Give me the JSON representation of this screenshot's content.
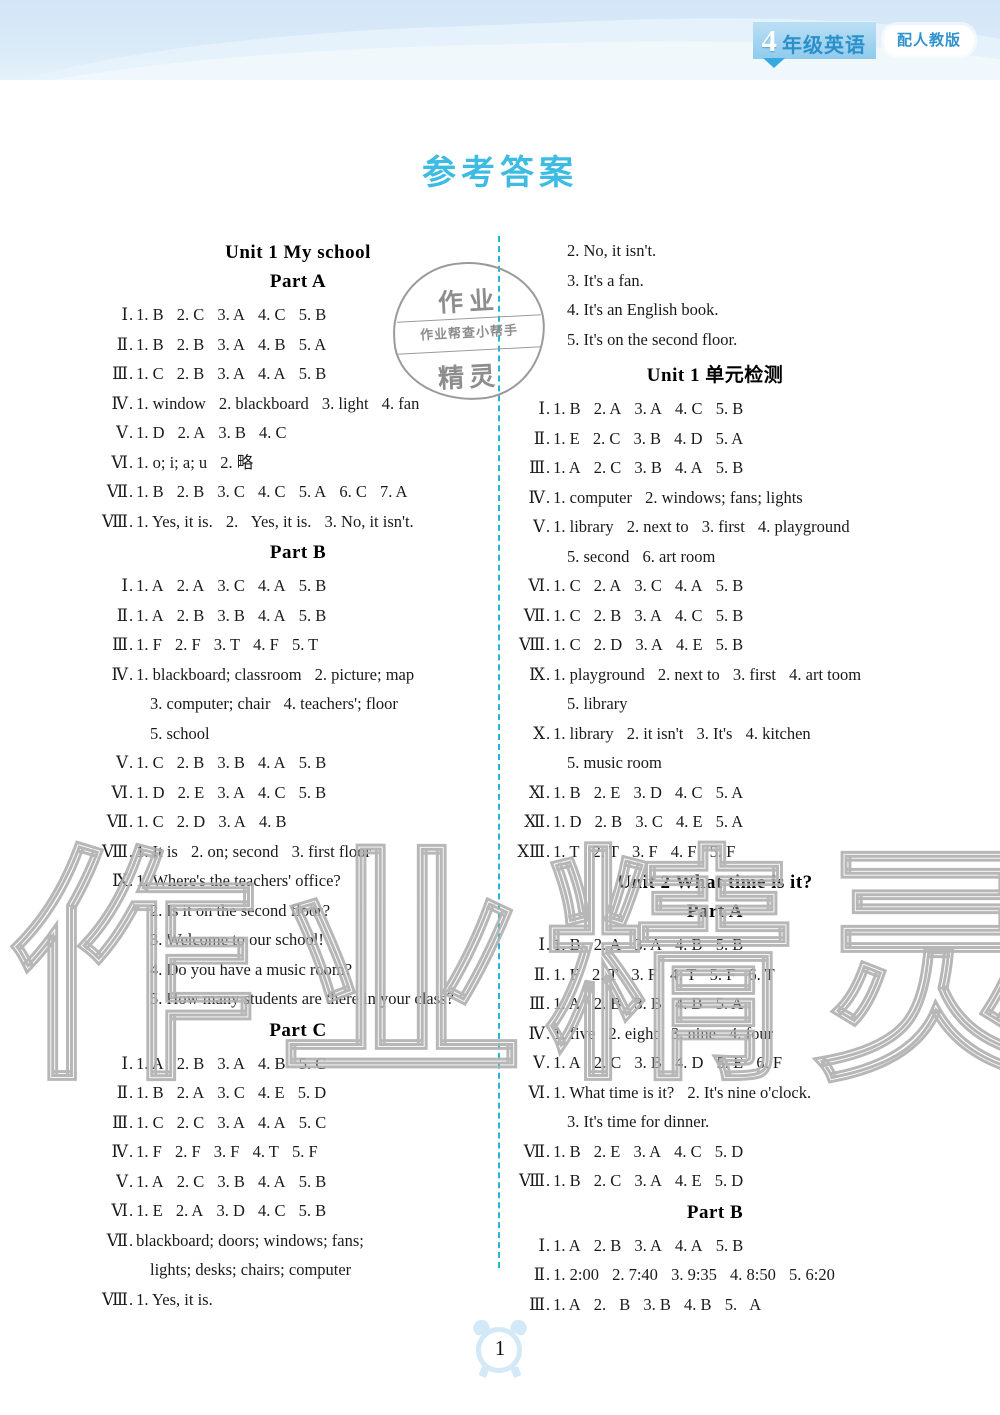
{
  "header": {
    "grade_number": "4",
    "grade_subject": "年级英语",
    "press_badge": "配人教版"
  },
  "page_title": "参考答案",
  "watermark": {
    "big_text": "作业精灵",
    "stamp_line1": "作业",
    "stamp_line2": "作业帮查小帮手",
    "stamp_line3": "精灵"
  },
  "footer": {
    "page_number": "1"
  },
  "left_column": [
    {
      "type": "head",
      "text": "Unit 1   My school"
    },
    {
      "type": "head",
      "text": "Part A"
    },
    {
      "type": "ans",
      "rn": "Ⅰ",
      "text": "1. B  2. C  3. A  4. C  5. B"
    },
    {
      "type": "ans",
      "rn": "Ⅱ",
      "text": "1. B  2. B  3. A  4. B  5. A"
    },
    {
      "type": "ans",
      "rn": "Ⅲ",
      "text": "1. C  2. B  3. A  4. A  5. B"
    },
    {
      "type": "ans",
      "rn": "Ⅳ",
      "text": "1. window  2. blackboard  3. light  4. fan"
    },
    {
      "type": "ans",
      "rn": "Ⅴ",
      "text": "1. D  2. A  3. B  4. C"
    },
    {
      "type": "ans",
      "rn": "Ⅵ",
      "text": "1. o; i; a; u  2. 略"
    },
    {
      "type": "ans",
      "rn": "Ⅶ",
      "text": "1. B  2. B  3. C  4. C  5. A  6. C  7. A"
    },
    {
      "type": "ans",
      "rn": "Ⅷ",
      "text": "1. Yes, it is.  2.  Yes, it is.  3. No, it isn't."
    },
    {
      "type": "head",
      "text": "Part B"
    },
    {
      "type": "ans",
      "rn": "Ⅰ",
      "text": "1. A  2. A  3. C  4. A  5. B"
    },
    {
      "type": "ans",
      "rn": "Ⅱ",
      "text": "1. A  2. B  3. B  4. A  5. B"
    },
    {
      "type": "ans",
      "rn": "Ⅲ",
      "text": "1. F  2. F  3. T  4. F  5. T"
    },
    {
      "type": "ans",
      "rn": "Ⅳ",
      "text": "1. blackboard; classroom  2. picture; map"
    },
    {
      "type": "cont",
      "text": "3. computer; chair  4. teachers'; floor"
    },
    {
      "type": "cont",
      "text": "5. school"
    },
    {
      "type": "ans",
      "rn": "Ⅴ",
      "text": "1. C  2. B  3. B  4. A  5. B"
    },
    {
      "type": "ans",
      "rn": "Ⅵ",
      "text": "1. D  2. E  3. A  4. C  5. B"
    },
    {
      "type": "ans",
      "rn": "Ⅶ",
      "text": "1. C  2. D  3. A  4. B"
    },
    {
      "type": "ans",
      "rn": "Ⅷ",
      "text": "1. It is  2. on; second  3. first floor"
    },
    {
      "type": "ans",
      "rn": "Ⅸ",
      "text": "1. Where's the teachers' office?"
    },
    {
      "type": "cont",
      "text": "2. Is it on the second floor?"
    },
    {
      "type": "cont",
      "text": "3. Welcome to our school!"
    },
    {
      "type": "cont",
      "text": "4. Do you have a music room?"
    },
    {
      "type": "cont",
      "text": "5. How many students are there in your class?"
    },
    {
      "type": "head",
      "text": "Part C"
    },
    {
      "type": "ans",
      "rn": "Ⅰ",
      "text": "1. A  2. B  3. A  4. B  5. C"
    },
    {
      "type": "ans",
      "rn": "Ⅱ",
      "text": "1. B  2. A  3. C  4. E  5. D"
    },
    {
      "type": "ans",
      "rn": "Ⅲ",
      "text": "1. C  2. C  3. A  4. A  5. C"
    },
    {
      "type": "ans",
      "rn": "Ⅳ",
      "text": "1. F  2. F  3. F  4. T  5. F"
    },
    {
      "type": "ans",
      "rn": "Ⅴ",
      "text": "1. A  2. C  3. B  4. A  5. B"
    },
    {
      "type": "ans",
      "rn": "Ⅵ",
      "text": "1. E  2. A  3. D  4. C  5. B"
    },
    {
      "type": "ans",
      "rn": "Ⅶ",
      "text": "blackboard; doors; windows; fans;"
    },
    {
      "type": "cont",
      "text": "lights; desks; chairs; computer"
    },
    {
      "type": "ans",
      "rn": "Ⅷ",
      "text": "1. Yes, it is."
    }
  ],
  "right_column": [
    {
      "type": "cont",
      "text": "2. No, it isn't."
    },
    {
      "type": "cont",
      "text": "3. It's a fan."
    },
    {
      "type": "cont",
      "text": "4. It's an English book."
    },
    {
      "type": "cont",
      "text": "5. It's on the second floor."
    },
    {
      "type": "head",
      "text": "Unit 1   单元检测"
    },
    {
      "type": "ans",
      "rn": "Ⅰ",
      "text": "1. B  2. A  3. A  4. C  5. B"
    },
    {
      "type": "ans",
      "rn": "Ⅱ",
      "text": "1. E  2. C  3. B  4. D  5. A"
    },
    {
      "type": "ans",
      "rn": "Ⅲ",
      "text": "1. A  2. C  3. B  4. A  5. B"
    },
    {
      "type": "ans",
      "rn": "Ⅳ",
      "text": "1. computer  2. windows; fans; lights"
    },
    {
      "type": "ans",
      "rn": "Ⅴ",
      "text": "1. library  2. next to  3. first  4. playground"
    },
    {
      "type": "cont",
      "text": "5. second  6. art room"
    },
    {
      "type": "ans",
      "rn": "Ⅵ",
      "text": "1. C  2. A  3. C  4. A  5. B"
    },
    {
      "type": "ans",
      "rn": "Ⅶ",
      "text": "1. C  2. B  3. A  4. C  5. B"
    },
    {
      "type": "ans",
      "rn": "Ⅷ",
      "text": "1. C  2. D  3. A  4. E  5. B"
    },
    {
      "type": "ans",
      "rn": "Ⅸ",
      "text": "1. playground  2. next to  3. first  4. art toom"
    },
    {
      "type": "cont",
      "text": "5. library"
    },
    {
      "type": "ans",
      "rn": "Ⅹ",
      "text": "1. library  2. it isn't  3. It's  4. kitchen"
    },
    {
      "type": "cont",
      "text": "5. music room"
    },
    {
      "type": "ans",
      "rn": "Ⅺ",
      "text": "1. B  2. E  3. D  4. C  5. A"
    },
    {
      "type": "ans",
      "rn": "Ⅻ",
      "text": "1. D  2. B  3. C  4. E  5. A"
    },
    {
      "type": "ans",
      "rn": "ⅩⅢ",
      "text": "1. T  2. T  3. F  4. F  5. F"
    },
    {
      "type": "head",
      "text": "Unit 2   What time is it?"
    },
    {
      "type": "head",
      "text": "Part A"
    },
    {
      "type": "ans",
      "rn": "Ⅰ",
      "text": "1. B  2. A  3. A  4. B  5. B"
    },
    {
      "type": "ans",
      "rn": "Ⅱ",
      "text": "1. F  2. T  3. F  4. T  5. F  6. T"
    },
    {
      "type": "ans",
      "rn": "Ⅲ",
      "text": "1. A  2. B  3. B  4. B  5. A"
    },
    {
      "type": "ans",
      "rn": "Ⅳ",
      "text": "1. five  2. eight  3. nine  4. four"
    },
    {
      "type": "ans",
      "rn": "Ⅴ",
      "text": "1. A  2. C  3. B  4. D  5. E  6. F"
    },
    {
      "type": "ans",
      "rn": "Ⅵ",
      "text": "1. What time is it?  2. It's nine o'clock."
    },
    {
      "type": "cont",
      "text": "3. It's time for dinner."
    },
    {
      "type": "ans",
      "rn": "Ⅶ",
      "text": "1. B  2. E  3. A  4. C  5. D"
    },
    {
      "type": "ans",
      "rn": "Ⅷ",
      "text": "1. B  2. C  3. A  4. E  5. D"
    },
    {
      "type": "head",
      "text": "Part B"
    },
    {
      "type": "ans",
      "rn": "Ⅰ",
      "text": "1. A  2. B  3. A  4. A  5. B"
    },
    {
      "type": "ans",
      "rn": "Ⅱ",
      "text": "1. 2:00  2. 7:40  3. 9:35  4. 8:50  5. 6:20"
    },
    {
      "type": "ans",
      "rn": "Ⅲ",
      "text": "1. A  2.  B  3. B  4. B  5.  A"
    }
  ]
}
